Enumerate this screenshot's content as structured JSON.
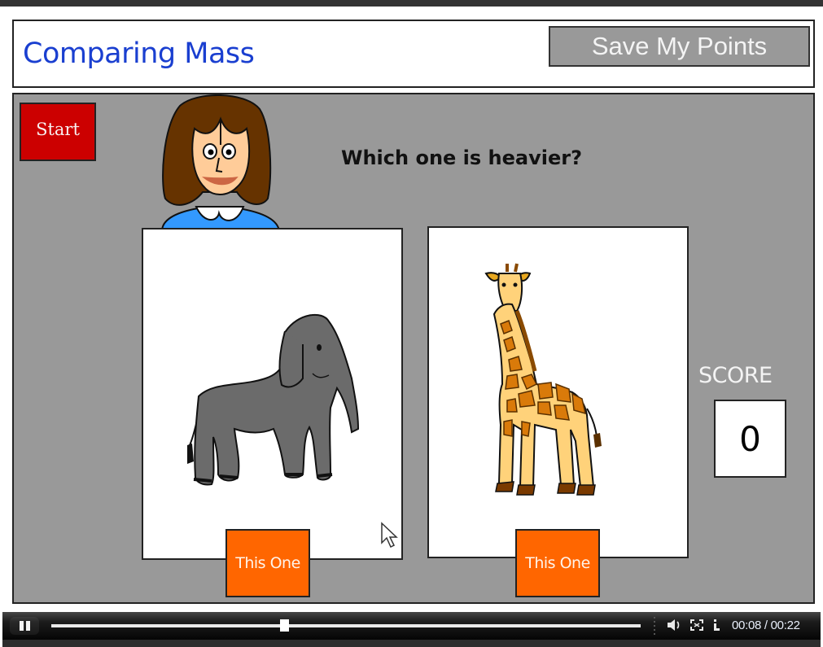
{
  "header": {
    "title": "Comparing Mass",
    "save_button_label": "Save My Points"
  },
  "game": {
    "start_button_label": "Start",
    "question": "Which one is heavier?",
    "options": [
      {
        "animal": "elephant",
        "button_label": "This One"
      },
      {
        "animal": "giraffe",
        "button_label": "This One"
      }
    ],
    "score_label": "SCORE",
    "score_value": "0"
  },
  "colors": {
    "title": "#1a3fd0",
    "start_button": "#cc0000",
    "choice_button": "#ff6600",
    "game_background": "#999999",
    "save_button": "#999999"
  },
  "player": {
    "state": "playing",
    "current_time": "00:08",
    "duration": "00:22",
    "time_display": "00:08 / 00:22",
    "progress_fraction": 0.3956,
    "icons": [
      "pause-icon",
      "volume-icon",
      "fullscreen-icon",
      "info-icon"
    ]
  }
}
